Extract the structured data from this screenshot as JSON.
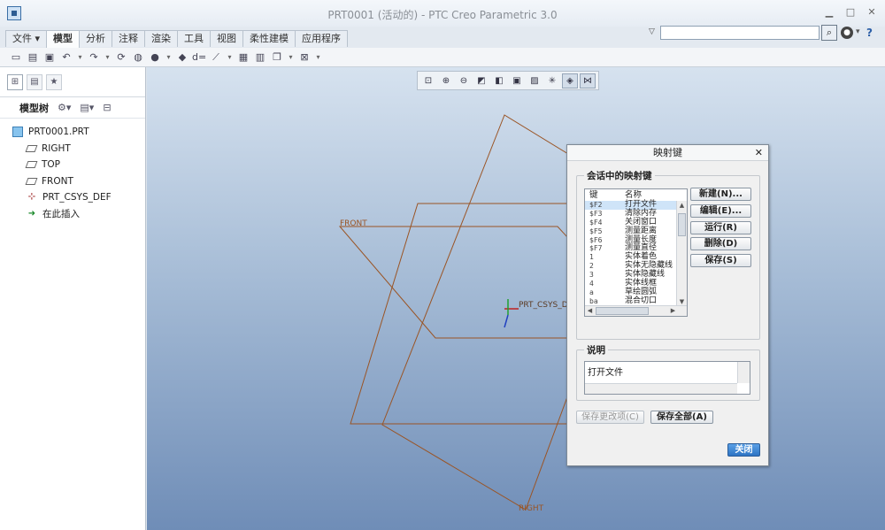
{
  "window": {
    "title": "PRT0001 (活动的) - PTC Creo Parametric 3.0",
    "icon": "creo-app-icon"
  },
  "menu": {
    "file_label": "文件",
    "tabs": [
      "模型",
      "分析",
      "注释",
      "渲染",
      "工具",
      "视图",
      "柔性建模",
      "应用程序"
    ],
    "active_tab": "模型"
  },
  "search": {
    "placeholder": ""
  },
  "left_panel": {
    "header_label": "模型树",
    "tree": [
      {
        "label": "PRT0001.PRT",
        "icon": "part-icon",
        "level": 0
      },
      {
        "label": "RIGHT",
        "icon": "datum-plane-icon",
        "level": 1
      },
      {
        "label": "TOP",
        "icon": "datum-plane-icon",
        "level": 1
      },
      {
        "label": "FRONT",
        "icon": "datum-plane-icon",
        "level": 1
      },
      {
        "label": "PRT_CSYS_DEF",
        "icon": "csys-icon",
        "level": 1
      },
      {
        "label": "在此插入",
        "icon": "insert-here-icon",
        "level": 1
      }
    ]
  },
  "graphics": {
    "labels": {
      "front": "FRONT",
      "right": "RIGHT",
      "csys": "PRT_CSYS_D"
    },
    "colors": {
      "datum": "#9a5424"
    }
  },
  "dialog": {
    "title": "映射键",
    "group1_title": "会话中的映射键",
    "columns": {
      "key": "键",
      "name": "名称"
    },
    "mapkeys": [
      {
        "key": "$F2",
        "name": "打开文件",
        "selected": true
      },
      {
        "key": "$F3",
        "name": "清除内存",
        "selected": false
      },
      {
        "key": "$F4",
        "name": "关闭窗口",
        "selected": false
      },
      {
        "key": "$F5",
        "name": "测量距离",
        "selected": false
      },
      {
        "key": "$F6",
        "name": "测量长度",
        "selected": false
      },
      {
        "key": "$F7",
        "name": "测量直径",
        "selected": false
      },
      {
        "key": "1",
        "name": "实体着色",
        "selected": false
      },
      {
        "key": "2",
        "name": "实体无隐藏线",
        "selected": false
      },
      {
        "key": "3",
        "name": "实体隐藏线",
        "selected": false
      },
      {
        "key": "4",
        "name": "实体线框",
        "selected": false
      },
      {
        "key": "a",
        "name": "草绘圆弧",
        "selected": false
      },
      {
        "key": "ba",
        "name": "混合切口",
        "selected": false
      }
    ],
    "buttons": {
      "new": "新建(N)...",
      "edit": "编辑(E)...",
      "run": "运行(R)",
      "delete": "删除(D)",
      "save": "保存(S)",
      "save_changes": "保存更改项(C)",
      "save_all": "保存全部(A)",
      "close": "关闭"
    },
    "desc_title": "说明",
    "description": "打开文件",
    "accent_color": "#2d74c4"
  }
}
